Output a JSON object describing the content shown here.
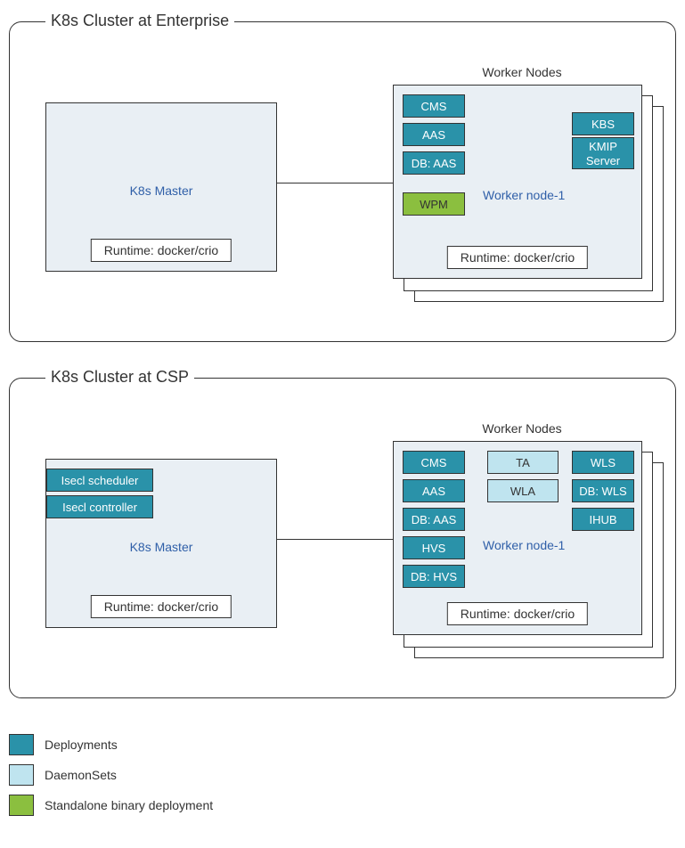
{
  "panels": {
    "enterprise": {
      "title": "K8s Cluster at Enterprise",
      "master_label": "K8s Master",
      "runtime": "Runtime: docker/crio",
      "worker_title": "Worker Nodes",
      "worker_node_label": "Worker node-1",
      "worker_runtime": "Runtime: docker/crio",
      "chips": {
        "cms": "CMS",
        "aas": "AAS",
        "dbaas": "DB: AAS",
        "wpm": "WPM",
        "kbs": "KBS",
        "kmip": "KMIP Server"
      }
    },
    "csp": {
      "title": "K8s Cluster at CSP",
      "master_label": "K8s Master",
      "runtime": "Runtime: docker/crio",
      "worker_title": "Worker Nodes",
      "worker_node_label": "Worker node-1",
      "worker_runtime": "Runtime: docker/crio",
      "master_chips": {
        "sched": "Isecl scheduler",
        "ctrl": "Isecl controller"
      },
      "chips": {
        "cms": "CMS",
        "aas": "AAS",
        "dbaas": "DB: AAS",
        "hvs": "HVS",
        "dbhvs": "DB: HVS",
        "ta": "TA",
        "wla": "WLA",
        "wls": "WLS",
        "dbwls": "DB: WLS",
        "ihub": "IHUB"
      }
    }
  },
  "legend": {
    "deploy": "Deployments",
    "daemon": "DaemonSets",
    "standalone": "Standalone binary deployment"
  },
  "colors": {
    "deploy": "#2a92a9",
    "daemon": "#bfe4ef",
    "standalone": "#8bbf3f"
  }
}
